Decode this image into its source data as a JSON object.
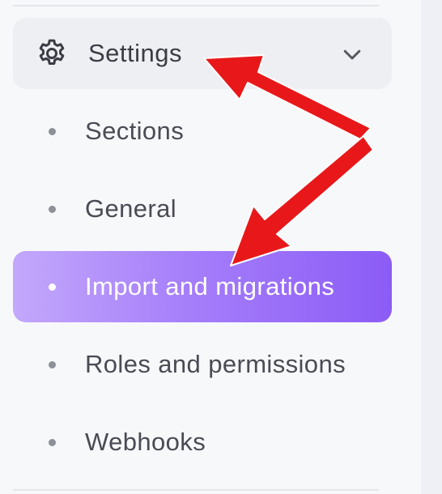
{
  "sidebar": {
    "header": {
      "label": "Settings",
      "icon": "gear-icon",
      "expand_icon": "chevron-down-icon"
    },
    "items": [
      {
        "label": "Sections",
        "active": false
      },
      {
        "label": "General",
        "active": false
      },
      {
        "label": "Import and migrations",
        "active": true
      },
      {
        "label": "Roles and permissions",
        "active": false
      },
      {
        "label": "Webhooks",
        "active": false
      }
    ]
  },
  "colors": {
    "active_gradient_start": "#c3a8fb",
    "active_gradient_end": "#8c5cf6",
    "annotation_arrow": "#e8181a",
    "text": "#4a4b54"
  }
}
